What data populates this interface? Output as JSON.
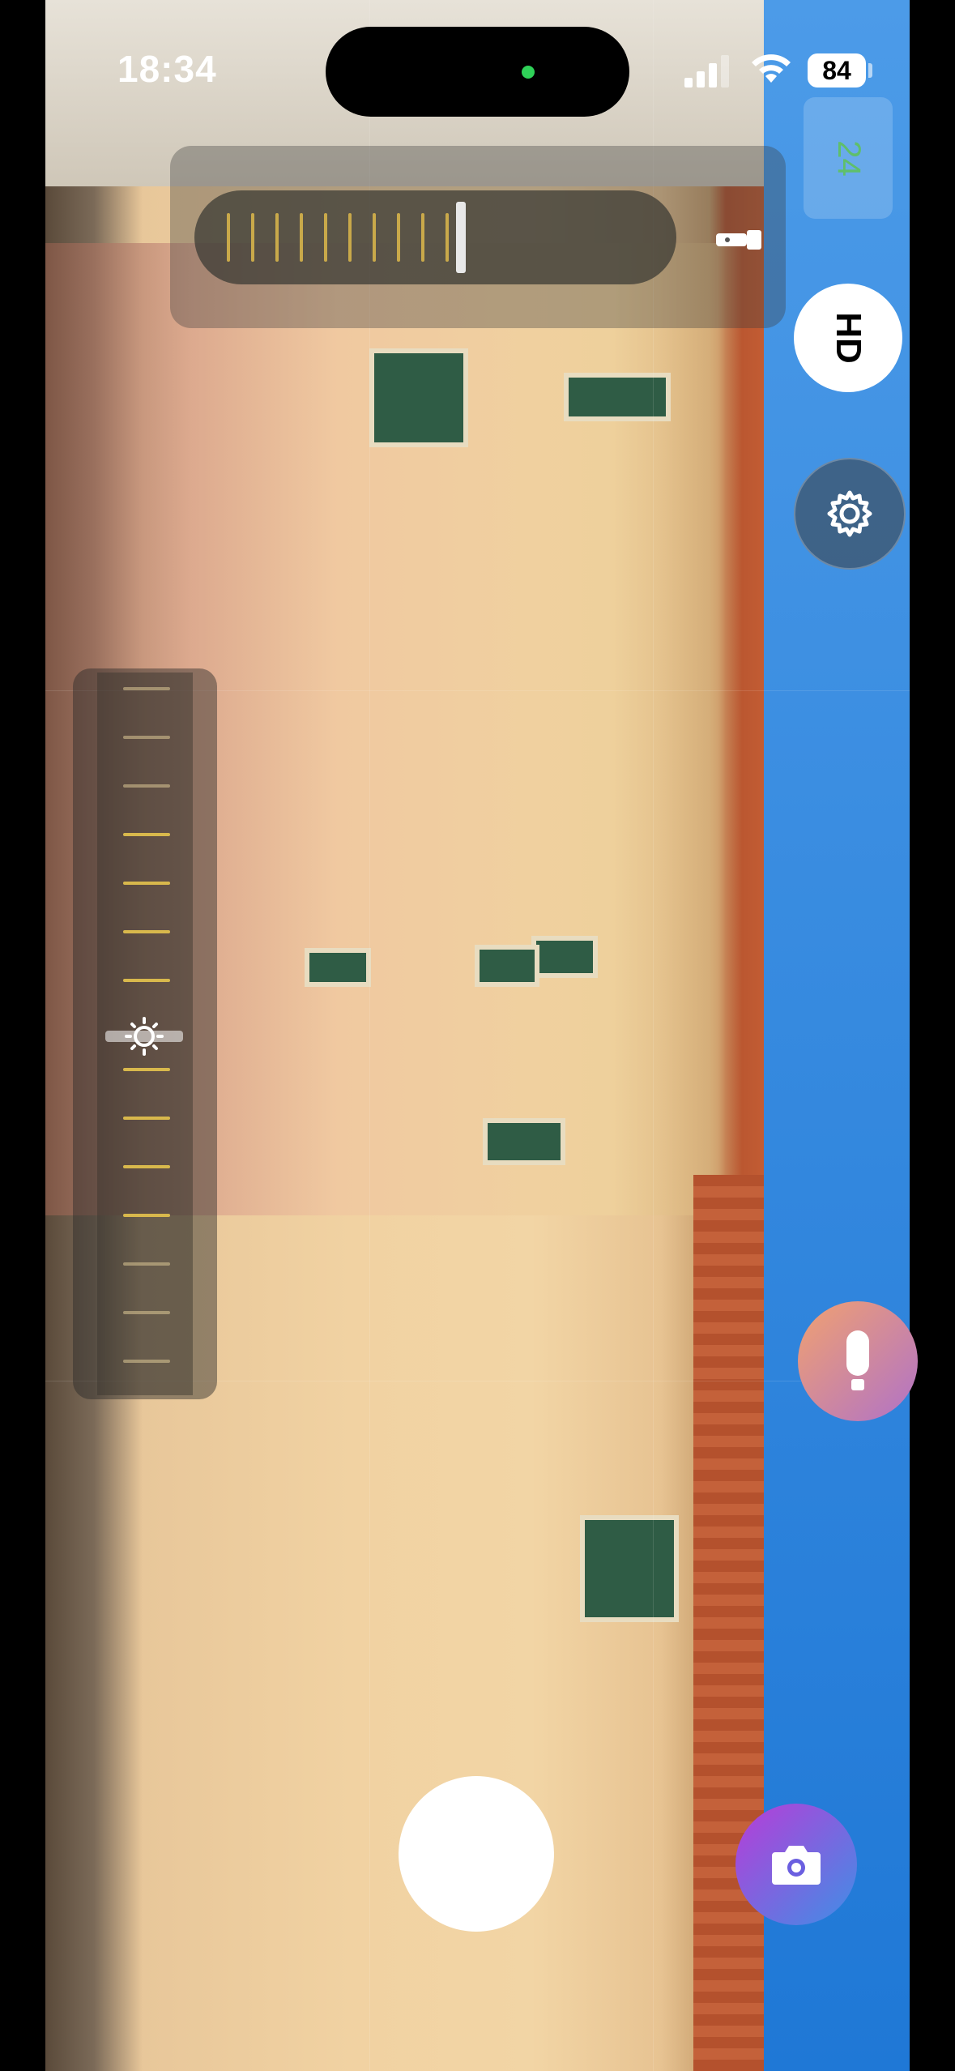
{
  "status_bar": {
    "time": "18:34",
    "battery": "84"
  },
  "top_panel": {
    "fps_label": "24",
    "zoom_level": 0.55
  },
  "right_controls": {
    "hd_label": "HD"
  },
  "exposure": {
    "level": 0.5
  },
  "icons": {
    "signal": "signal-icon",
    "wifi": "wifi-icon",
    "torch": "torch-icon",
    "settings": "gear-icon",
    "microphone": "microphone-icon",
    "camera": "camera-icon",
    "exposure": "sun-icon"
  },
  "colors": {
    "accent_tick": "#c9a94a",
    "fps_green": "#5fbf6b",
    "mic_gradient": [
      "#f1a170",
      "#b072c8"
    ],
    "camera_gradient": [
      "#b83cd8",
      "#3f8fe6"
    ]
  }
}
